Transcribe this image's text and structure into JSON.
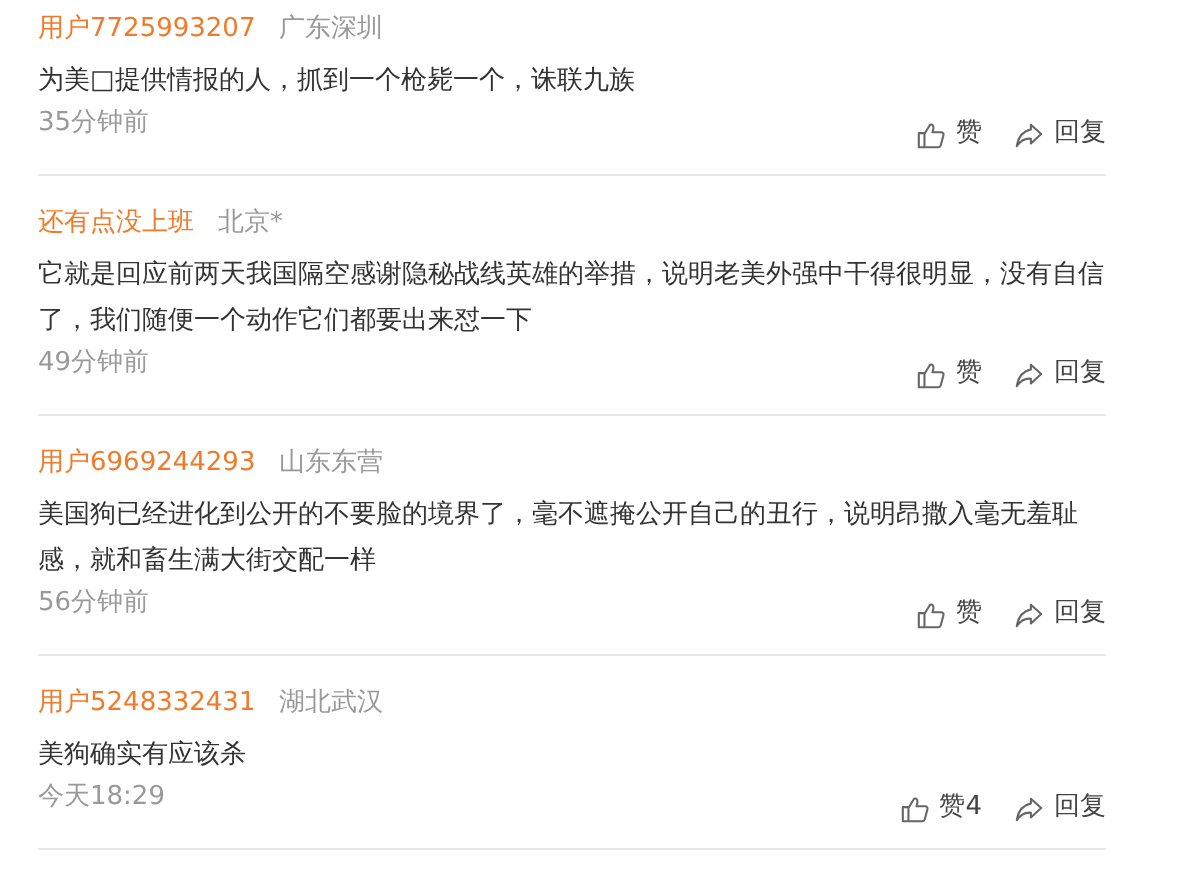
{
  "comments": [
    {
      "user": "用户7725993207",
      "location": "广东深圳",
      "text": "为美□提供情报的人，抓到一个枪毙一个，诛联九族",
      "time": "35分钟前",
      "like": "赞",
      "reply": "回复"
    },
    {
      "user": "还有点没上班",
      "location": "北京*",
      "text": "它就是回应前两天我国隔空感谢隐秘战线英雄的举措，说明老美外强中干得很明显，没有自信了，我们随便一个动作它们都要出来怼一下",
      "time": "49分钟前",
      "like": "赞",
      "reply": "回复"
    },
    {
      "user": "用户6969244293",
      "location": "山东东营",
      "text": "美国狗已经进化到公开的不要脸的境界了，毫不遮掩公开自己的丑行，说明昂撒入毫无羞耻感，就和畜生满大街交配一样",
      "time": "56分钟前",
      "like": "赞",
      "reply": "回复"
    },
    {
      "user": "用户5248332431",
      "location": "湖北武汉",
      "text": "美狗确实有应该杀",
      "time": "今天18:29",
      "like": "赞4",
      "reply": "回复"
    }
  ]
}
